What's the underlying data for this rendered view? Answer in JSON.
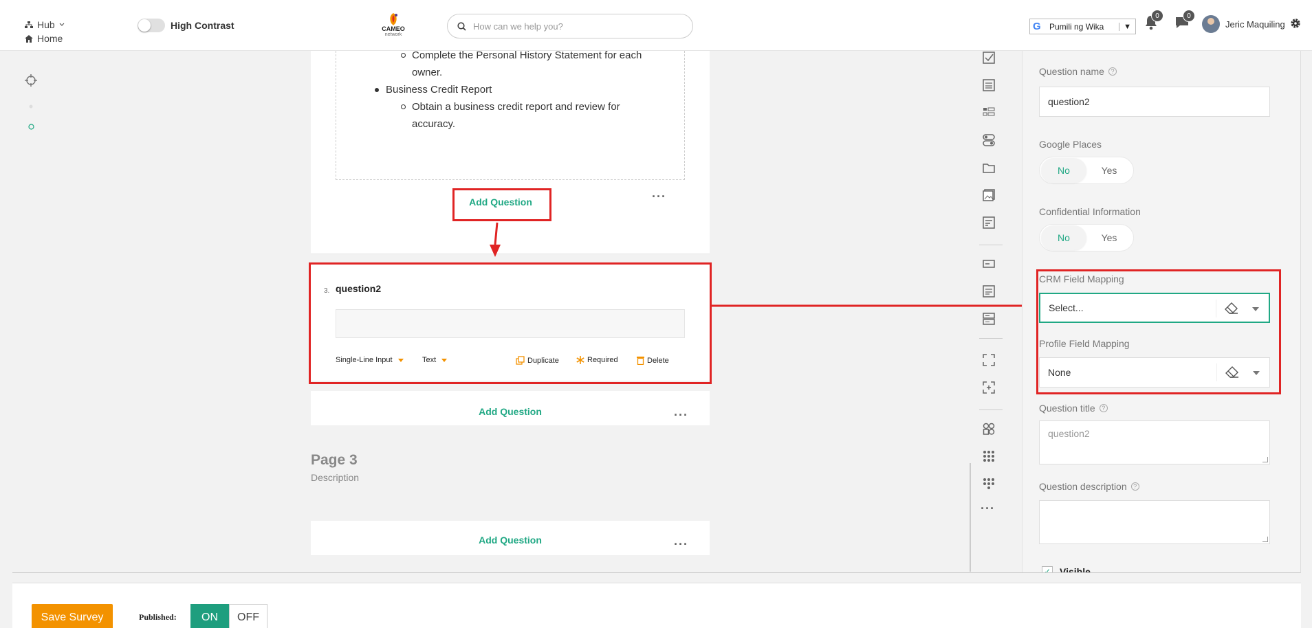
{
  "topbar": {
    "hub_label": "Hub",
    "home_label": "Home",
    "high_contrast_label": "High Contrast",
    "logo_line1": "CAMEO",
    "logo_line2": "network",
    "search_placeholder": "How can we help you?",
    "translate_label": "Pumili ng Wika",
    "notifications_count": "0",
    "messages_count": "0",
    "user_name": "Jeric Maquiling"
  },
  "content": {
    "list_items": [
      "Complete the Personal History Statement for each",
      "owner.",
      "Business Credit Report",
      "Obtain a business credit report and review for",
      "accuracy."
    ],
    "add_question_label": "Add Question",
    "more_label": "···",
    "question": {
      "number": "3.",
      "name": "question2",
      "type_label": "Single-Line Input",
      "subtype_label": "Text",
      "duplicate_label": "Duplicate",
      "required_label": "Required",
      "delete_label": "Delete"
    },
    "page3_title": "Page 3",
    "page3_description": "Description"
  },
  "panel": {
    "question_name_label": "Question name",
    "question_name_value": "question2",
    "google_places_label": "Google Places",
    "confidential_label": "Confidential Information",
    "no_label": "No",
    "yes_label": "Yes",
    "crm_label": "CRM Field Mapping",
    "crm_value": "Select...",
    "profile_label": "Profile Field Mapping",
    "profile_value": "None",
    "question_title_label": "Question title",
    "question_title_placeholder": "question2",
    "question_description_label": "Question description",
    "visible_label": "Visible"
  },
  "bottombar": {
    "save_label": "Save Survey",
    "published_label": "Published:",
    "on_label": "ON",
    "off_label": "OFF"
  },
  "colors": {
    "accent": "#20a884",
    "annotation_red": "#e02424",
    "save_orange": "#f39200"
  }
}
